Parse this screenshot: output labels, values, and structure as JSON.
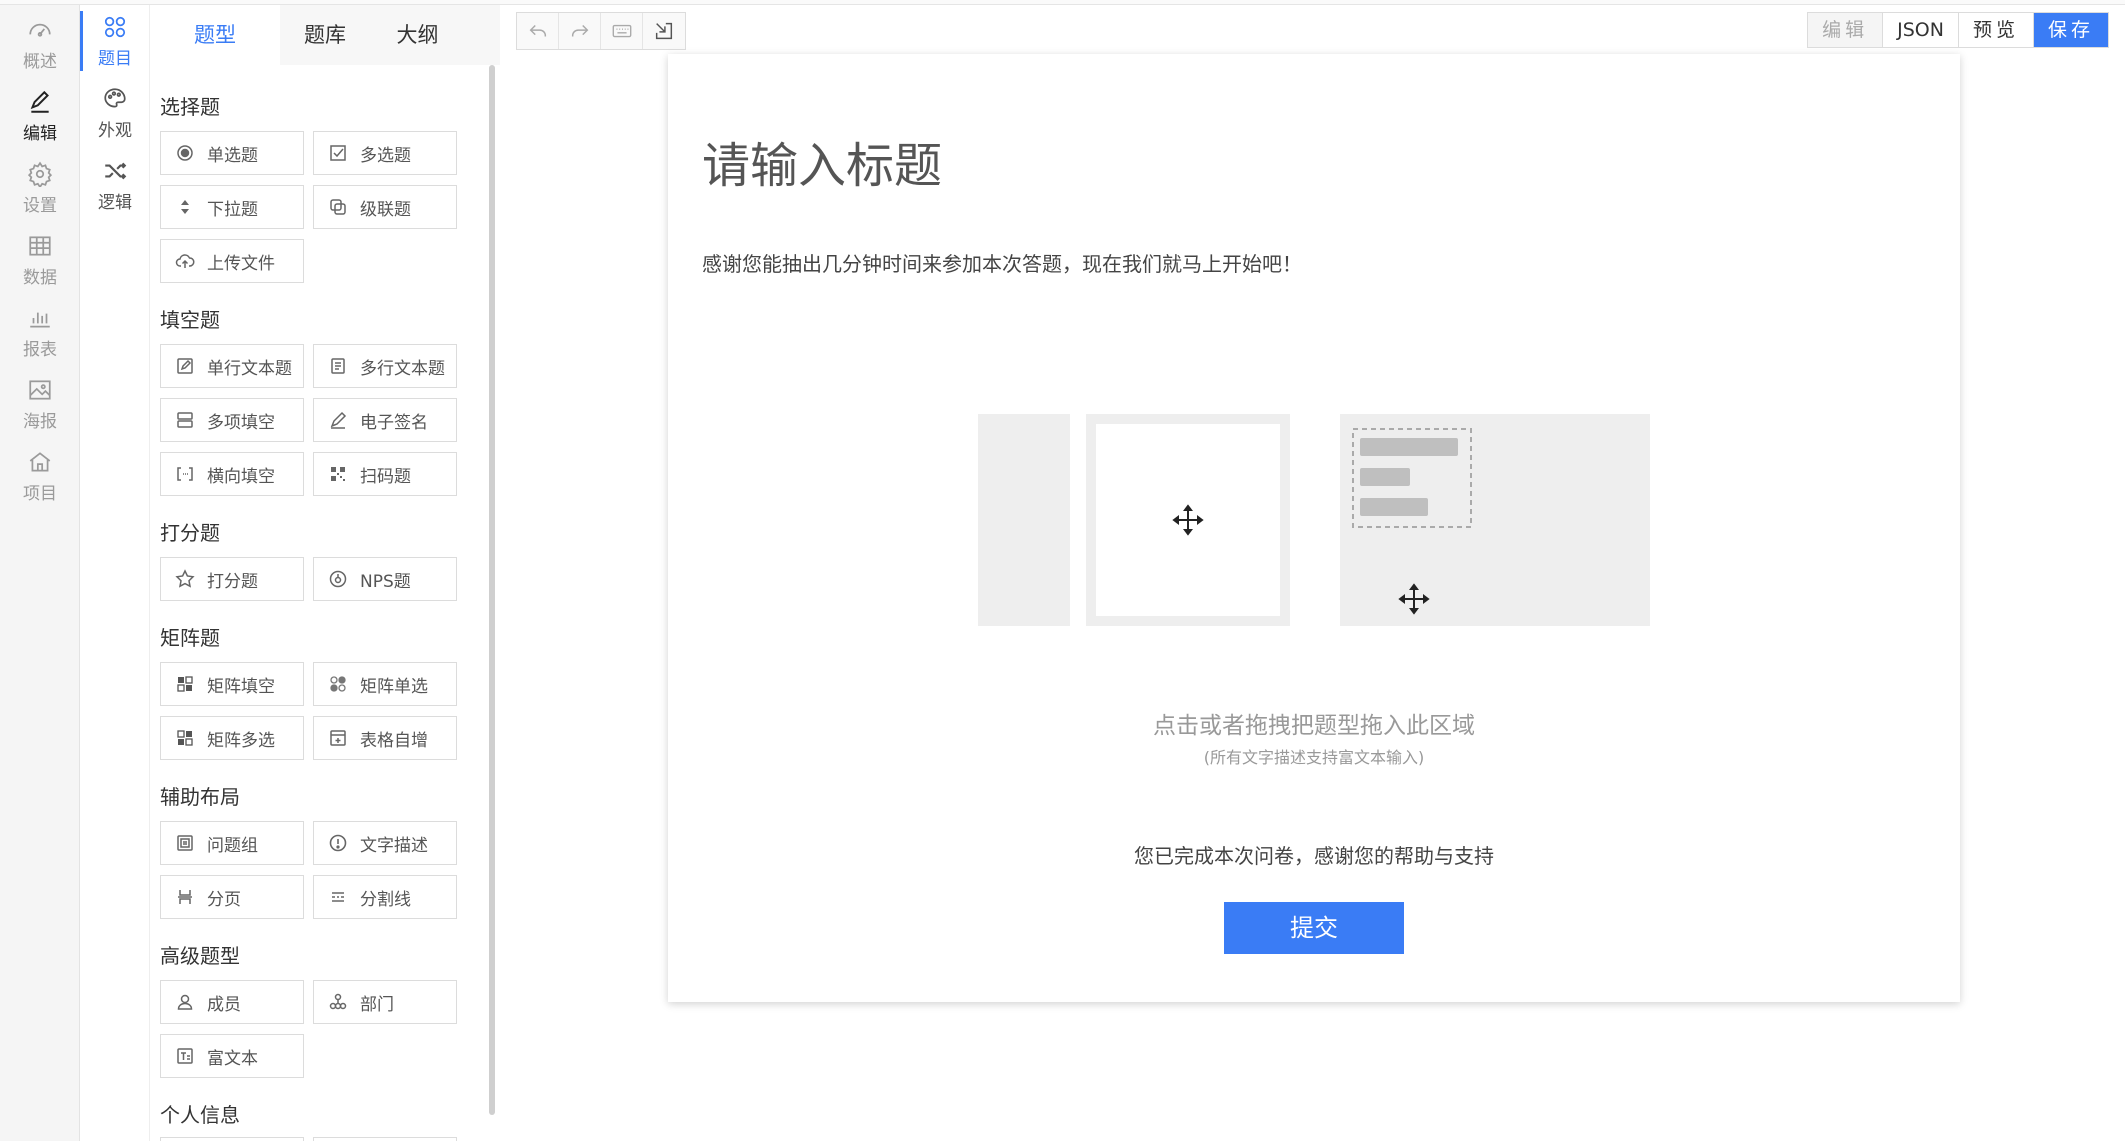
{
  "nav_primary": [
    {
      "label": "概述",
      "icon": "dashboard-icon"
    },
    {
      "label": "编辑",
      "icon": "pen-icon",
      "active": true
    },
    {
      "label": "设置",
      "icon": "gear-icon"
    },
    {
      "label": "数据",
      "icon": "table-icon"
    },
    {
      "label": "报表",
      "icon": "bar-chart-icon"
    },
    {
      "label": "海报",
      "icon": "image-icon"
    },
    {
      "label": "项目",
      "icon": "home-icon"
    }
  ],
  "nav_secondary": [
    {
      "label": "题目",
      "icon": "grid-icon",
      "active": true
    },
    {
      "label": "外观",
      "icon": "palette-icon"
    },
    {
      "label": "逻辑",
      "icon": "shuffle-icon"
    }
  ],
  "panel": {
    "tabs": [
      "题型",
      "题库",
      "大纲"
    ],
    "groups": {
      "choice": {
        "title": "选择题",
        "items": [
          "单选题",
          "多选题",
          "下拉题",
          "级联题",
          "上传文件"
        ]
      },
      "fill": {
        "title": "填空题",
        "items": [
          "单行文本题",
          "多行文本题",
          "多项填空",
          "电子签名",
          "横向填空",
          "扫码题"
        ]
      },
      "score": {
        "title": "打分题",
        "items": [
          "打分题",
          "NPS题"
        ]
      },
      "matrix": {
        "title": "矩阵题",
        "items": [
          "矩阵填空",
          "矩阵单选",
          "矩阵多选",
          "表格自增"
        ]
      },
      "layout": {
        "title": "辅助布局",
        "items": [
          "问题组",
          "文字描述",
          "分页",
          "分割线"
        ]
      },
      "advanced": {
        "title": "高级题型",
        "items": [
          "成员",
          "部门",
          "富文本"
        ]
      },
      "personal": {
        "title": "个人信息"
      }
    }
  },
  "toolbar": {
    "right": [
      "编辑",
      "JSON",
      "预览",
      "保存"
    ]
  },
  "survey": {
    "title": "请输入标题",
    "description": "感谢您能抽出几分钟时间来参加本次答题，现在我们就马上开始吧！",
    "drop_hint": "点击或者拖拽把题型拖入此区域",
    "drop_sub": "(所有文字描述支持富文本输入)",
    "finish_text": "您已完成本次问卷，感谢您的帮助与支持",
    "submit_label": "提交"
  },
  "colors": {
    "accent": "#3a7cf5"
  }
}
